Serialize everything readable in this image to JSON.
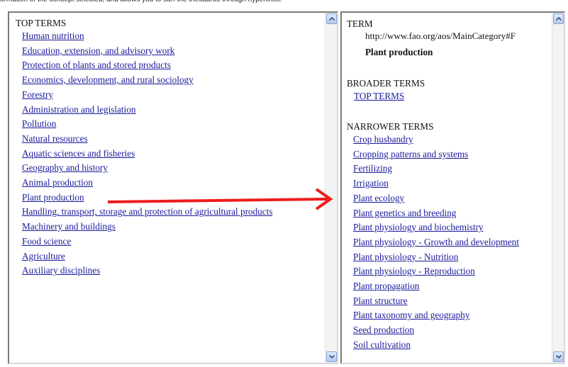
{
  "caption": "ormation of the concept selected, and allows you to surf the thesaurus through hyperlinks.",
  "left_panel": {
    "heading": "TOP TERMS",
    "items": [
      "Human nutrition",
      "Education, extension, and advisory work",
      "Protection of plants and stored products",
      "Economics, development, and rural sociology",
      "Forestry",
      "Administration and legislation",
      "Pollution",
      "Natural resources",
      "Aquatic sciences and fisheries",
      "Geography and history",
      "Animal production",
      "Plant production",
      "Handling, transport, storage and protection of agricultural products",
      "Machinery and buildings",
      "Food science",
      "Agriculture",
      "Auxiliary disciplines"
    ]
  },
  "right_panel": {
    "term_heading": "TERM",
    "term_uri": "http://www.fao.org/aos/MainCategory#F",
    "term_label": "Plant production",
    "broader_heading": "BROADER TERMS",
    "broader_items": [
      "TOP TERMS"
    ],
    "narrower_heading": "NARROWER TERMS",
    "narrower_items": [
      "Crop husbandry",
      "Cropping patterns and systems",
      "Fertilizing",
      "Irrigation",
      "Plant ecology",
      "Plant genetics and breeding",
      "Plant physiology and biochemistry",
      "Plant physiology - Growth and development",
      "Plant physiology - Nutrition",
      "Plant physiology - Reproduction",
      "Plant propagation",
      "Plant structure",
      "Plant taxonomy and geography",
      "Seed production",
      "Soil cultivation"
    ]
  },
  "annotation": {
    "arrow_color": "#ee1c1c"
  },
  "colors": {
    "link": "#1a1a9a",
    "scroll_button": "#b5c8ef"
  },
  "icons": {
    "scroll_up": "chevron-up-icon",
    "scroll_down": "chevron-down-icon"
  }
}
